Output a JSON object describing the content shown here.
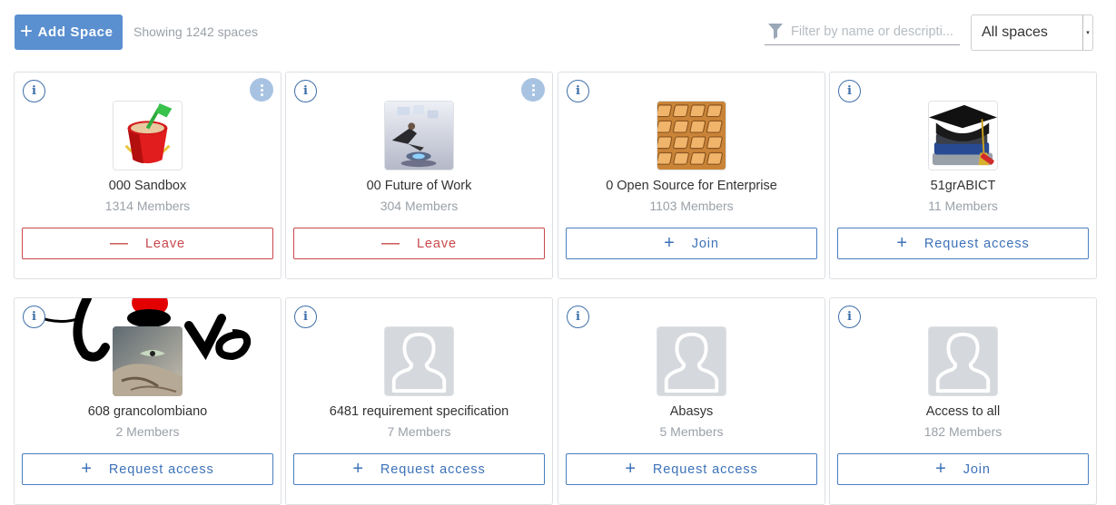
{
  "toolbar": {
    "add_space_label": "Add Space",
    "showing_text": "Showing 1242 spaces",
    "filter_placeholder": "Filter by name or descripti...",
    "filter_value": "",
    "scope_selected": "All spaces"
  },
  "spaces": [
    {
      "name": "000 Sandbox",
      "members": "1314 Members",
      "action": "Leave",
      "action_icon": "minus-icon",
      "has_more_menu": true,
      "avatar": "sand-bucket-image"
    },
    {
      "name": "00 Future of Work",
      "members": "304 Members",
      "action": "Leave",
      "action_icon": "minus-icon",
      "has_more_menu": true,
      "avatar": "future-work-image"
    },
    {
      "name": "0 Open Source for Enterprise",
      "members": "1103 Members",
      "action": "Join",
      "action_icon": "plus-icon",
      "has_more_menu": false,
      "avatar": "keyboard-image"
    },
    {
      "name": "51grABICT",
      "members": "11 Members",
      "action": "Request access",
      "action_icon": "plus-icon",
      "has_more_menu": false,
      "avatar": "graduation-cap-image"
    },
    {
      "name": "608 grancolombiano",
      "members": "2 Members",
      "action": "Request access",
      "action_icon": "plus-icon",
      "has_more_menu": false,
      "avatar": "cat-image"
    },
    {
      "name": "6481 requirement specification",
      "members": "7 Members",
      "action": "Request access",
      "action_icon": "plus-icon",
      "has_more_menu": false,
      "avatar": "default-avatar"
    },
    {
      "name": "Abasys",
      "members": "5 Members",
      "action": "Request access",
      "action_icon": "plus-icon",
      "has_more_menu": false,
      "avatar": "default-avatar"
    },
    {
      "name": "Access to all",
      "members": "182 Members",
      "action": "Join",
      "action_icon": "plus-icon",
      "has_more_menu": false,
      "avatar": "default-avatar"
    }
  ],
  "colors": {
    "primary": "#5a8fd0",
    "leave": "#c8484a",
    "join": "#3d72b8",
    "muted": "#9aa1a8"
  }
}
